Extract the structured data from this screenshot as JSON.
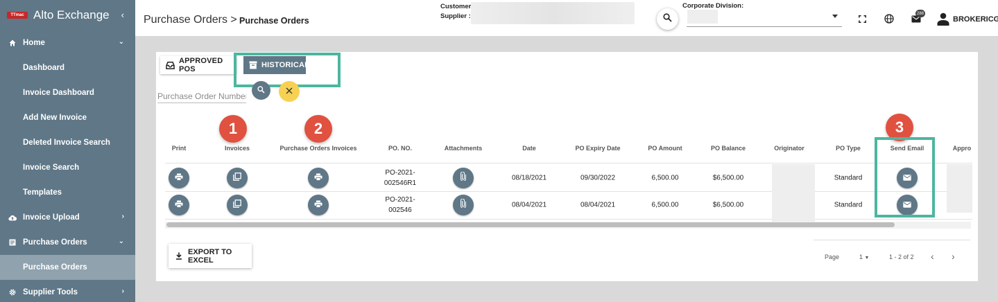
{
  "app": {
    "logo_text": "TTmac",
    "title": "Alto Exchange",
    "collapse_icon": "chevron-left-icon"
  },
  "sidebar": {
    "home": {
      "label": "Home",
      "icon": "home-icon"
    },
    "home_items": [
      "Dashboard",
      "Invoice Dashboard",
      "Add New Invoice",
      "Deleted Invoice Search",
      "Invoice Search",
      "Templates"
    ],
    "invoice_upload": {
      "label": "Invoice Upload",
      "icon": "cloud-upload-icon"
    },
    "purchase_orders": {
      "label": "Purchase Orders",
      "icon": "list-icon"
    },
    "purchase_orders_items": [
      "Purchase Orders"
    ],
    "supplier_tools": {
      "label": "Supplier Tools",
      "icon": "gear-icon"
    }
  },
  "header": {
    "breadcrumb_parent": "Purchase Orders >",
    "breadcrumb_current": "Purchase Orders",
    "customer_label": "Customer",
    "supplier_label": "Supplier :",
    "corporate_division_label": "Corporate Division:",
    "notification_count": "288",
    "username": "BROKERICG"
  },
  "tabs": {
    "approved": "APPROVED POS",
    "historical": "HISTORICAL"
  },
  "search": {
    "placeholder": "Purchase Order Number"
  },
  "callouts": [
    "1",
    "2",
    "3"
  ],
  "table": {
    "columns": [
      "Print",
      "Invoices",
      "Purchase Orders Invoices",
      "PO. NO.",
      "Attachments",
      "Date",
      "PO Expiry Date",
      "PO Amount",
      "PO Balance",
      "Originator",
      "PO Type",
      "Send Email",
      "Appro"
    ],
    "rows": [
      {
        "po_no_line1": "PO-2021-",
        "po_no_line2": "002546R1",
        "date": "08/18/2021",
        "expiry": "09/30/2022",
        "amount": "6,500.00",
        "balance": "$6,500.00",
        "type": "Standard"
      },
      {
        "po_no_line1": "PO-2021-",
        "po_no_line2": "002546",
        "date": "08/04/2021",
        "expiry": "08/04/2021",
        "amount": "6,500.00",
        "balance": "$6,500.00",
        "type": "Standard"
      }
    ]
  },
  "footer": {
    "export_label": "EXPORT TO EXCEL",
    "page_label": "Page",
    "page_value": "1",
    "range": "1 - 2 of 2"
  },
  "colors": {
    "sidebar": "#5f7787",
    "highlight": "#4db6a0",
    "callout": "#e05140",
    "clear": "#f7d154"
  }
}
